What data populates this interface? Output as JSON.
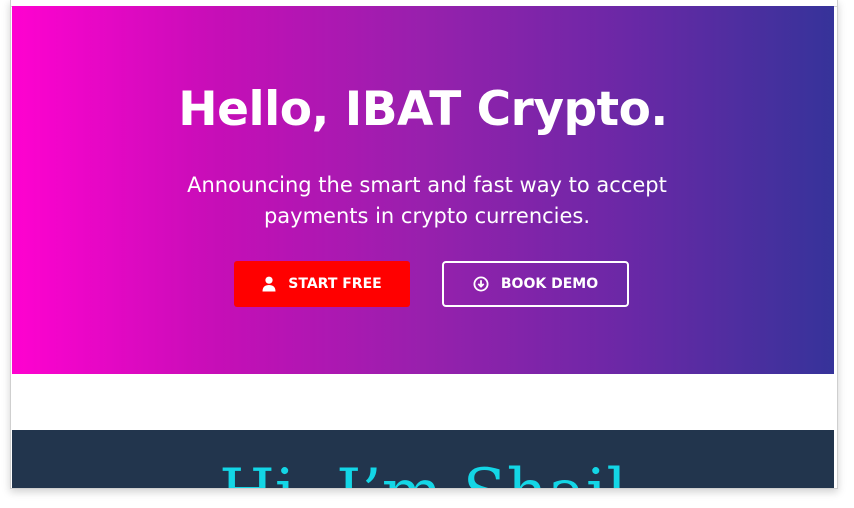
{
  "hero": {
    "title": "Hello, IBAT Crypto.",
    "subtitle": "Announcing the smart and fast way to accept payments in crypto currencies.",
    "gradient_start": "#ff02d0",
    "gradient_end": "#36339a",
    "buttons": {
      "start_free": {
        "label": "START FREE",
        "icon": "user-icon",
        "color": "#ff0000"
      },
      "book_demo": {
        "label": "BOOK DEMO",
        "icon": "download-circle-icon"
      }
    }
  },
  "next_section": {
    "heading": "Hi, I’m Shail",
    "background": "#22354d",
    "heading_color": "#13d6e6"
  }
}
